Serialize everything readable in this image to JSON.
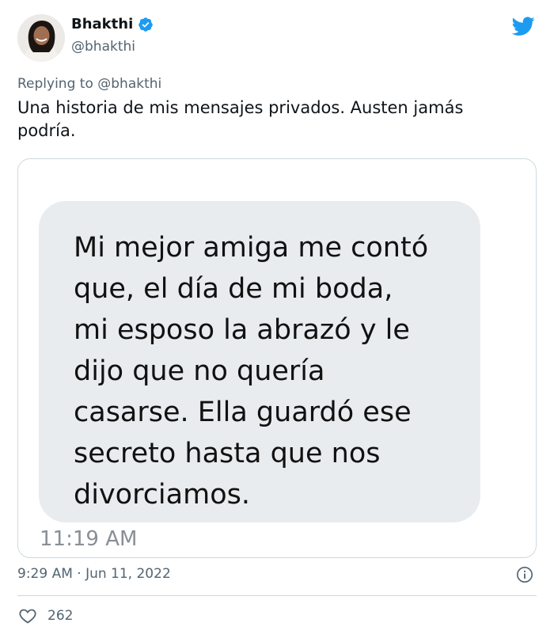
{
  "author": {
    "name": "Bhakthi",
    "handle": "@bhakthi",
    "verified": true
  },
  "reply": {
    "prefix": "Replying to ",
    "mention": "@bhakthi"
  },
  "tweet": {
    "text": "Una historia de mis mensajes privados. Austen jamás podría.",
    "timestamp": "9:29 AM · Jun 11, 2022"
  },
  "media": {
    "message_text": "Mi mejor amiga me contó\nque, el día de mi boda,\nmi esposo la abrazó y le\ndijo que no quería\ncasarse. Ella guardó ese\nsecreto hasta que nos\ndivorciamos.",
    "message_time": "11:19 AM"
  },
  "engagement": {
    "likes": "262"
  },
  "colors": {
    "twitter_blue": "#1d9bf0",
    "text_secondary": "#536471",
    "bubble_bg": "#e9ecee"
  },
  "icons": [
    "verified-badge-icon",
    "twitter-bird-icon",
    "info-icon",
    "heart-icon"
  ]
}
